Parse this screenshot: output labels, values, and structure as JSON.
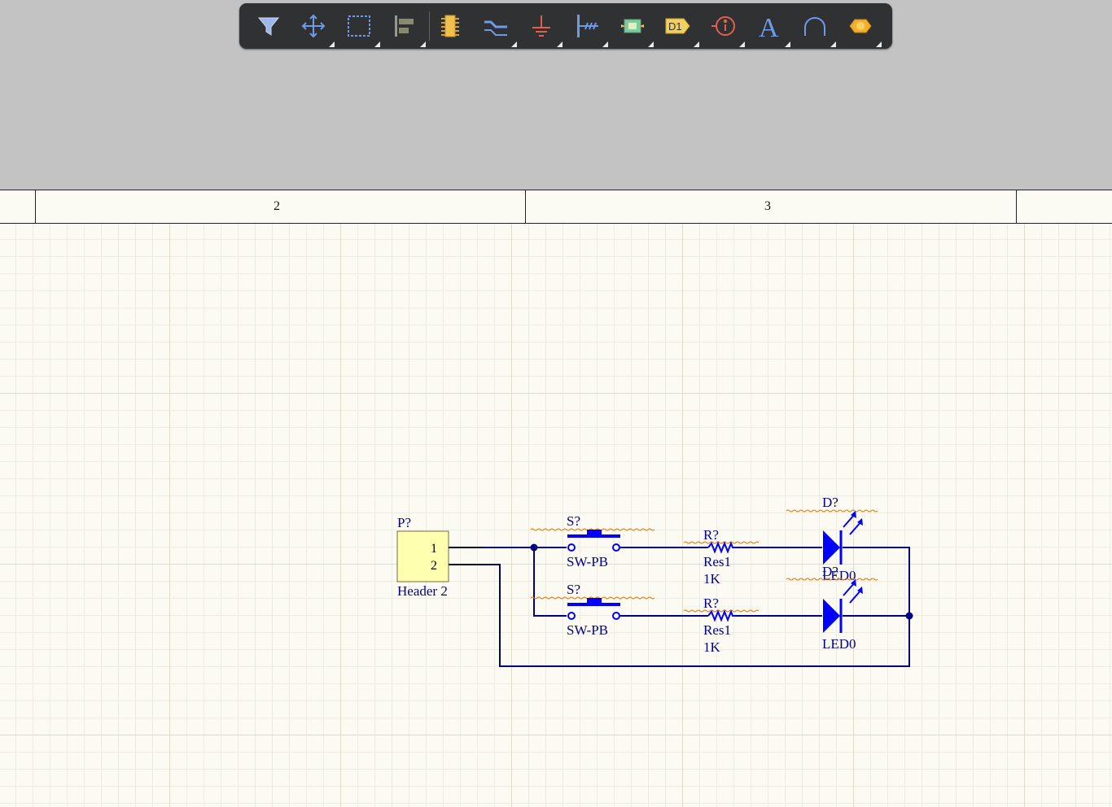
{
  "toolbar": {
    "buttons": [
      {
        "name": "filter-icon"
      },
      {
        "name": "move-icon"
      },
      {
        "name": "select-rectangle-icon"
      },
      {
        "name": "align-icon"
      },
      {
        "name": "component-icon"
      },
      {
        "name": "bus-entry-icon"
      },
      {
        "name": "power-port-icon"
      },
      {
        "name": "harness-icon"
      },
      {
        "name": "sheet-symbol-icon"
      },
      {
        "name": "port-icon"
      },
      {
        "name": "directive-icon"
      },
      {
        "name": "text-icon"
      },
      {
        "name": "arc-icon"
      },
      {
        "name": "hole-icon"
      }
    ],
    "port_label": "D1",
    "text_label": "A"
  },
  "ruler": {
    "zones": [
      "2",
      "3"
    ]
  },
  "schematic": {
    "header": {
      "designator": "P?",
      "comment": "Header 2",
      "pin1": "1",
      "pin2": "2"
    },
    "switches": [
      {
        "designator": "S?",
        "comment": "SW-PB"
      },
      {
        "designator": "S?",
        "comment": "SW-PB"
      }
    ],
    "resistors": [
      {
        "designator": "R?",
        "comment": "Res1",
        "value": "1K"
      },
      {
        "designator": "R?",
        "comment": "Res1",
        "value": "1K"
      }
    ],
    "leds": [
      {
        "designator": "D?",
        "comment": "LED0"
      },
      {
        "designator": "D?",
        "comment": "LED0"
      }
    ]
  },
  "colors": {
    "wire": "#000080",
    "component": "#0000ff",
    "label": "#00008b",
    "header_fill": "#ffffb0",
    "squiggle": "#e07000",
    "sheet": "#fcfbf3",
    "toolbar": "#2f3133"
  }
}
